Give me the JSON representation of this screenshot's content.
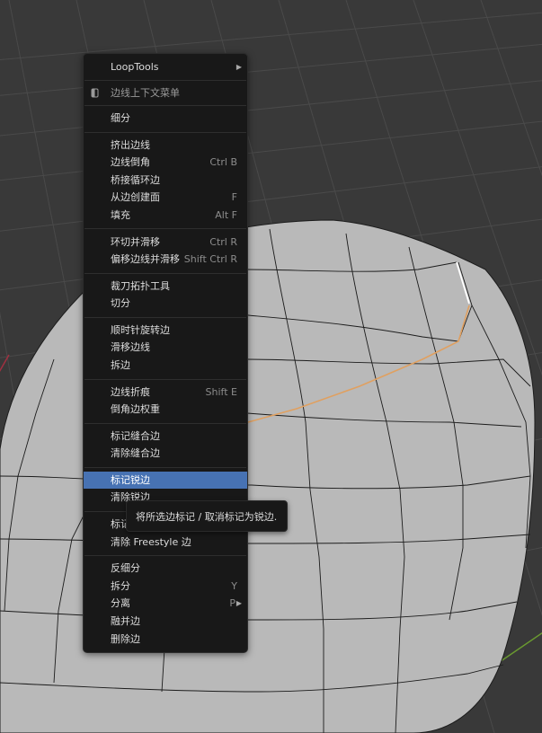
{
  "colors": {
    "background": "#393939",
    "grid_line": "#4a4a4a",
    "mesh_fill": "#b9b9b9",
    "mesh_edges": "#1c1c1c",
    "selected_edge": "#ffffff",
    "edge_loop": "#e0a060",
    "menu_bg": "#181818",
    "highlight": "#4772b3",
    "shortcut_text": "#8c8c8c"
  },
  "menu": {
    "items": [
      {
        "label": "LoopTools",
        "shortcut": "",
        "has_submenu": true
      },
      {
        "label": "边线上下文菜单",
        "shortcut": "",
        "icon": "pin-icon"
      },
      {
        "label": "细分",
        "shortcut": ""
      },
      {
        "label": "挤出边线",
        "shortcut": ""
      },
      {
        "label": "边线倒角",
        "shortcut": "Ctrl B"
      },
      {
        "label": "桥接循环边",
        "shortcut": ""
      },
      {
        "label": "从边创建面",
        "shortcut": "F"
      },
      {
        "label": "填充",
        "shortcut": "Alt F"
      },
      {
        "label": "环切并滑移",
        "shortcut": "Ctrl R"
      },
      {
        "label": "偏移边线并滑移",
        "shortcut": "Shift Ctrl R"
      },
      {
        "label": "裁刀拓扑工具",
        "shortcut": ""
      },
      {
        "label": "切分",
        "shortcut": ""
      },
      {
        "label": "顺时针旋转边",
        "shortcut": ""
      },
      {
        "label": "滑移边线",
        "shortcut": ""
      },
      {
        "label": "拆边",
        "shortcut": ""
      },
      {
        "label": "边线折痕",
        "shortcut": "Shift E"
      },
      {
        "label": "倒角边权重",
        "shortcut": ""
      },
      {
        "label": "标记缝合边",
        "shortcut": ""
      },
      {
        "label": "清除缝合边",
        "shortcut": ""
      },
      {
        "label": "标记锐边",
        "shortcut": "",
        "highlighted": true
      },
      {
        "label": "清除锐边",
        "shortcut": ""
      },
      {
        "label": "标记",
        "shortcut": ""
      },
      {
        "label": "清除 Freestyle 边",
        "shortcut": ""
      },
      {
        "label": "反细分",
        "shortcut": ""
      },
      {
        "label": "拆分",
        "shortcut": "Y"
      },
      {
        "label": "分离",
        "shortcut": "P",
        "has_submenu": true
      },
      {
        "label": "融并边",
        "shortcut": ""
      },
      {
        "label": "删除边",
        "shortcut": ""
      }
    ]
  },
  "tooltip": {
    "text": "将所选边标记 / 取消标记为锐边."
  }
}
